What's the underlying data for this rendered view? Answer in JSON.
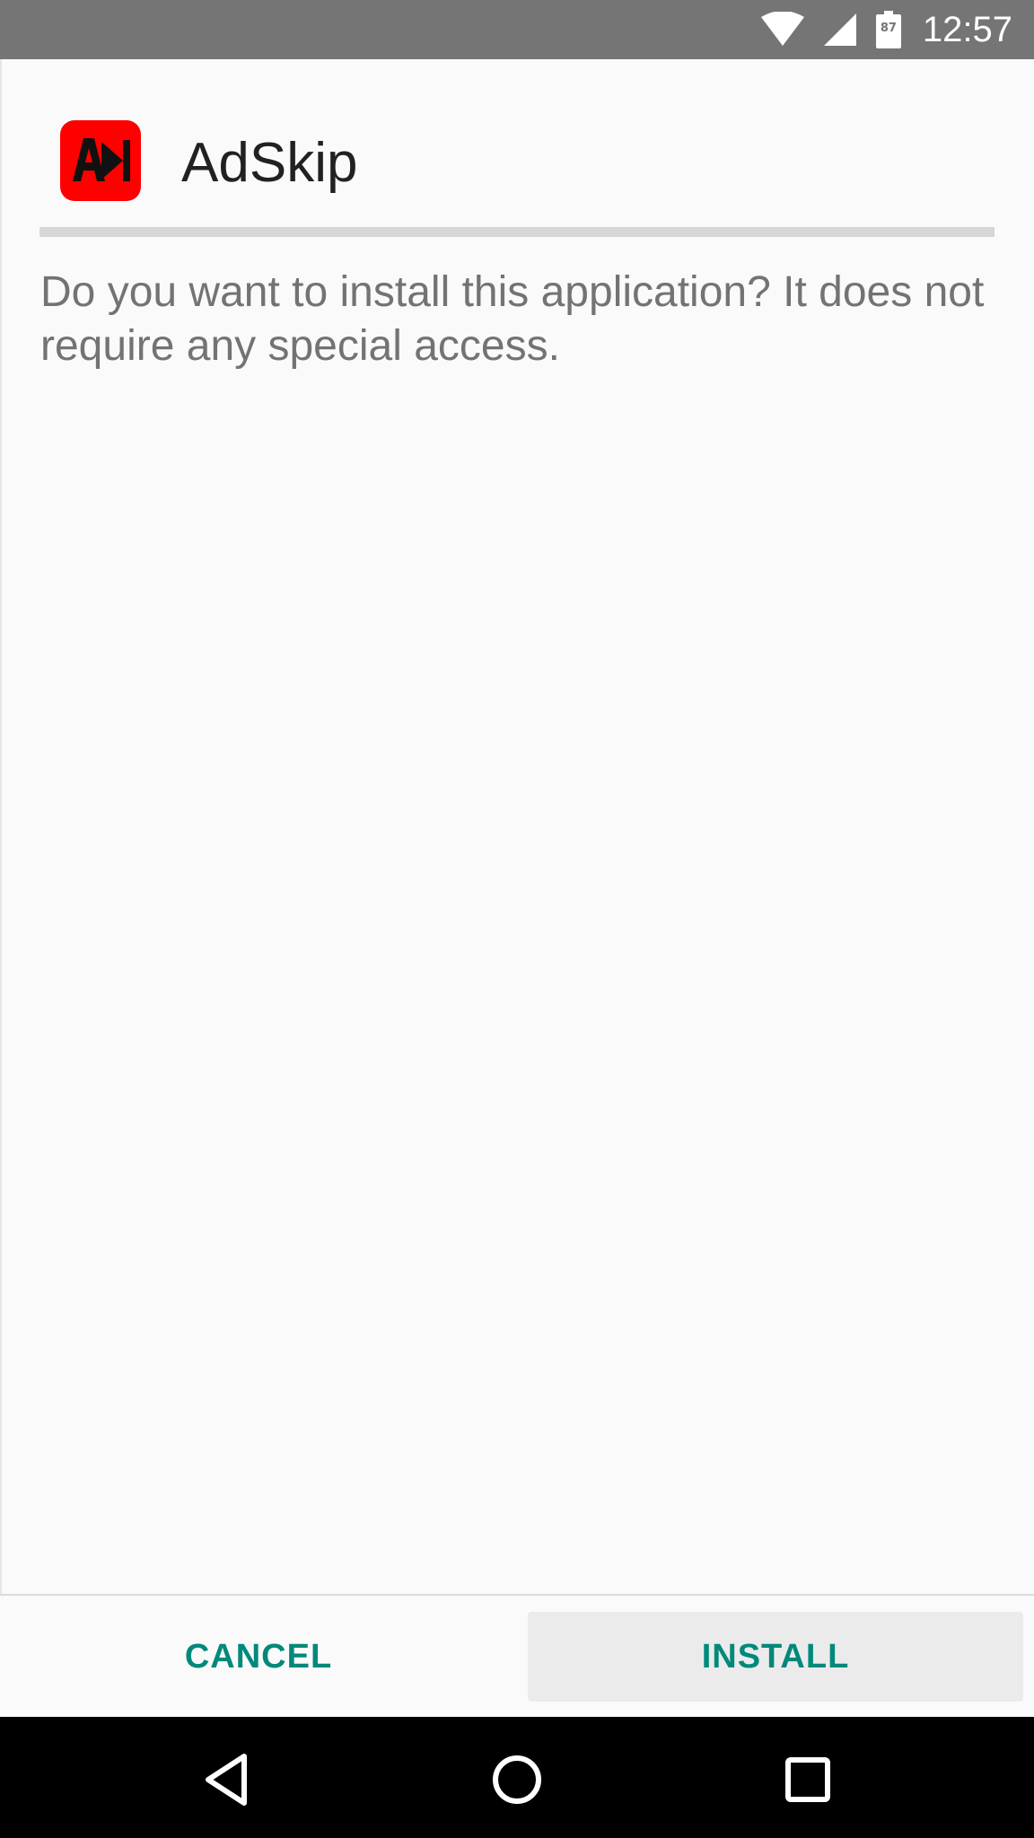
{
  "status_bar": {
    "battery_level": "87",
    "time": "12:57",
    "icons": [
      "wifi-icon",
      "cell-signal-icon",
      "battery-icon"
    ],
    "background": "#757575"
  },
  "app": {
    "name": "AdSkip",
    "icon": "adskip-logo-icon",
    "icon_color": "#ff0000"
  },
  "dialog": {
    "message": "Do you want to install this application? It does not require any special access."
  },
  "buttons": {
    "cancel_label": "CANCEL",
    "install_label": "INSTALL",
    "accent_color": "#00897b"
  },
  "nav_bar": {
    "icons": [
      "back-icon",
      "home-icon",
      "recents-icon"
    ]
  }
}
